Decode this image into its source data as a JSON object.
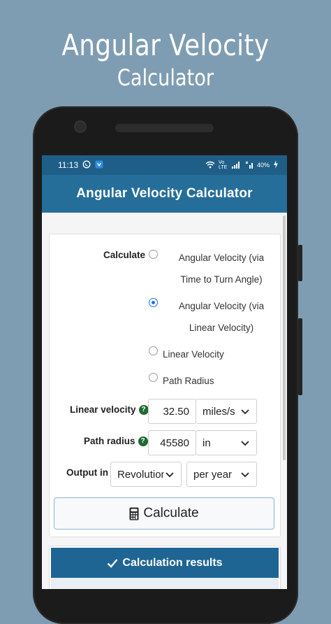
{
  "promo": {
    "title_line1": "Angular Velocity",
    "title_line2": "Calculator"
  },
  "status_bar": {
    "time": "11:13",
    "battery": "40%",
    "network": "Vo LTE"
  },
  "app_bar": {
    "title": "Angular Velocity Calculator"
  },
  "form": {
    "calculate_label": "Calculate",
    "options": [
      {
        "line1": "Angular Velocity (via",
        "line2": "Time to Turn Angle)",
        "selected": false
      },
      {
        "line1": "Angular Velocity (via",
        "line2": "Linear Velocity)",
        "selected": true
      },
      {
        "line1": "Linear Velocity",
        "selected": false
      },
      {
        "line1": "Path Radius",
        "selected": false
      }
    ],
    "linear_velocity": {
      "label": "Linear velocity",
      "value": "32.50",
      "unit": "miles/s"
    },
    "path_radius": {
      "label": "Path radius",
      "value": "45580",
      "unit": "in"
    },
    "output": {
      "label": "Output in",
      "unit": "Revolution",
      "period": "per year"
    },
    "calculate_button": "Calculate",
    "help_symbol": "?"
  },
  "results": {
    "header": "Calculation results"
  },
  "colors": {
    "background": "#7f9db2",
    "app_bar": "#256e99",
    "status_bar": "#1f5f87",
    "accent": "#1a73e8",
    "help": "#1e6b2f"
  },
  "icons": [
    "whatsapp-icon",
    "app-notification-icon",
    "wifi-icon",
    "signal-icon",
    "battery-icon",
    "calculator-icon",
    "check-icon",
    "chevron-down-icon",
    "help-icon"
  ]
}
